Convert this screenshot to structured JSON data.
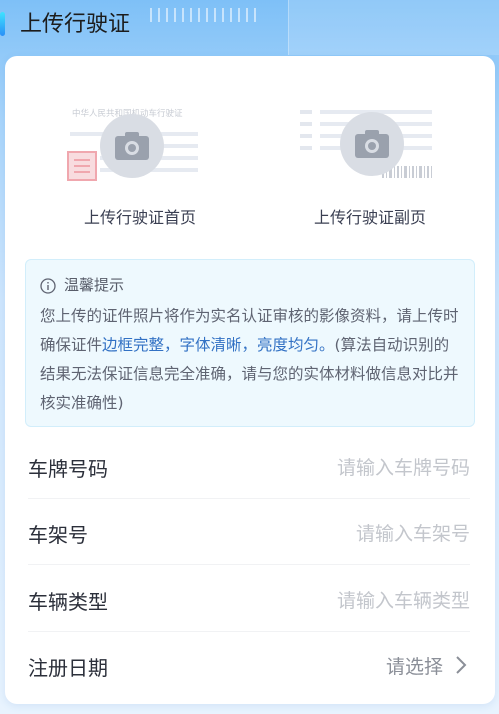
{
  "header": {
    "title": "上传行驶证"
  },
  "uploads": {
    "front": {
      "label": "上传行驶证首页",
      "watermark": "中华人民共和国机动车行驶证"
    },
    "back": {
      "label": "上传行驶证副页"
    }
  },
  "notice": {
    "title": "温馨提示",
    "text_part1": "您上传的证件照片将作为实名认证审核的影像资料，请上传时确保证件",
    "highlight": "边框完整，字体清晰，亮度均匀。",
    "text_part2": "(算法自动识别的结果无法保证信息完全准确，请与您的实体材料做信息对比并核实准确性)"
  },
  "form": {
    "plate": {
      "label": "车牌号码",
      "placeholder": "请输入车牌号码"
    },
    "vin": {
      "label": "车架号",
      "placeholder": "请输入车架号"
    },
    "type": {
      "label": "车辆类型",
      "placeholder": "请输入车辆类型"
    },
    "date": {
      "label": "注册日期",
      "placeholder": "请选择"
    }
  },
  "colors": {
    "accent": "#2a8ff7",
    "highlight": "#3271c4",
    "notice_bg": "#eef9fe"
  }
}
